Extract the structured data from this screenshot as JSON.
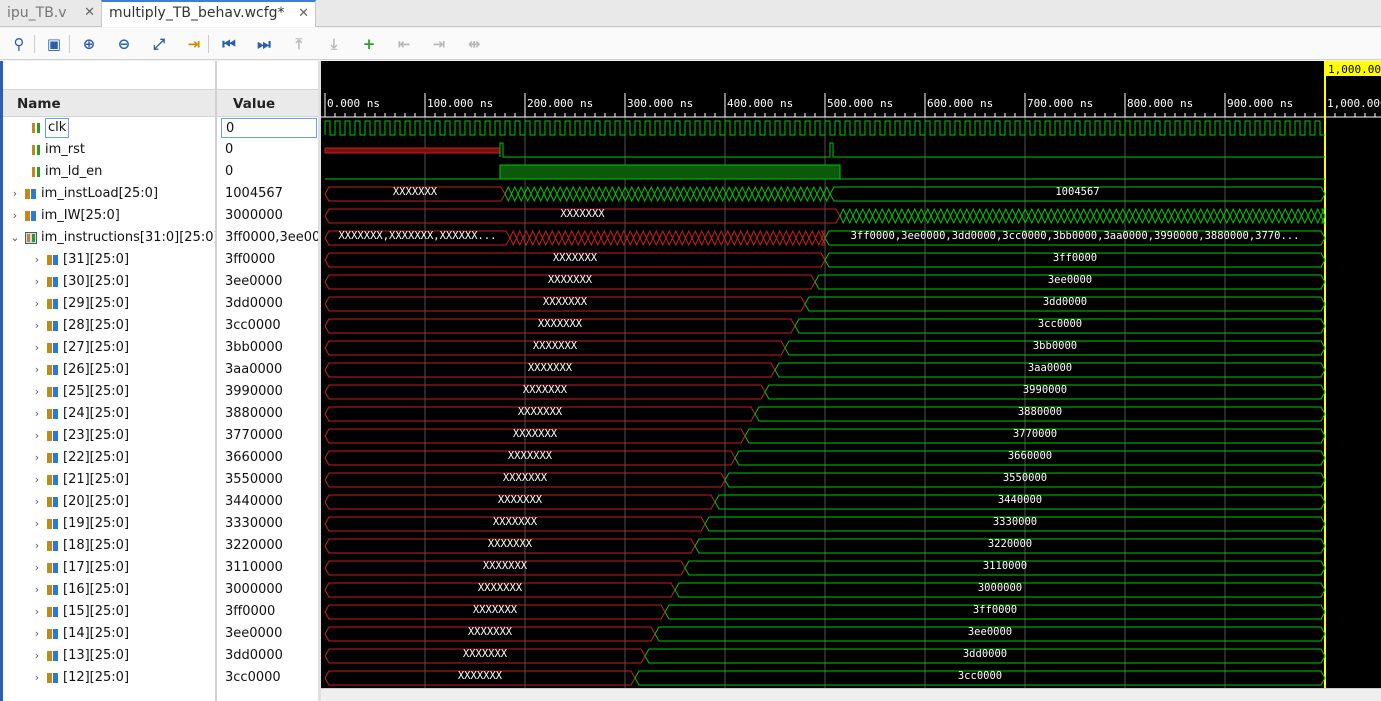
{
  "tabs": [
    {
      "label": "ipu_TB.v",
      "active": false
    },
    {
      "label": "multiply_TB_behav.wcfg*",
      "active": true
    }
  ],
  "toolbar_icons": [
    "search-icon",
    "save-icon",
    "zoom-in-icon",
    "zoom-out-icon",
    "zoom-fit-icon",
    "go-to-cursor-icon",
    "go-to-time-zero-icon",
    "go-to-last-time-icon",
    "previous-transition-icon",
    "next-transition-icon",
    "add-marker-icon",
    "previous-marker-icon",
    "next-marker-icon",
    "swap-cursors-icon"
  ],
  "columns": {
    "name": "Name",
    "value": "Value"
  },
  "time_axis": {
    "ticks": [
      "0.000 ns",
      "100.000 ns",
      "200.000 ns",
      "300.000 ns",
      "400.000 ns",
      "500.000 ns",
      "600.000 ns",
      "700.000 ns",
      "800.000 ns",
      "900.000 ns",
      "1,000.000 ns"
    ],
    "cursor_label": "1,000.000 ns",
    "cursor_ns": 1000
  },
  "colors": {
    "wave_green": "#00c800",
    "wave_red": "#c81e1e",
    "cursor": "#ffff00",
    "grid": "#505050"
  },
  "signals": [
    {
      "name": "clk",
      "value": "0",
      "kind": "bit",
      "expandable": false,
      "indent": 0
    },
    {
      "name": "im_rst",
      "value": "0",
      "kind": "bit",
      "expandable": false,
      "indent": 0
    },
    {
      "name": "im_ld_en",
      "value": "0",
      "kind": "bit",
      "expandable": false,
      "indent": 0
    },
    {
      "name": "im_instLoad[25:0]",
      "value": "1004567",
      "kind": "bus",
      "expandable": true,
      "expanded": false,
      "indent": 0
    },
    {
      "name": "im_IW[25:0]",
      "value": "3000000",
      "kind": "bus",
      "expandable": true,
      "expanded": false,
      "indent": 0
    },
    {
      "name": "im_instructions[31:0][25:0]",
      "value": "3ff0000,3ee00",
      "kind": "array",
      "expandable": true,
      "expanded": true,
      "indent": 0
    },
    {
      "name": "[31][25:0]",
      "value": "3ff0000",
      "kind": "bus",
      "expandable": true,
      "indent": 1
    },
    {
      "name": "[30][25:0]",
      "value": "3ee0000",
      "kind": "bus",
      "expandable": true,
      "indent": 1
    },
    {
      "name": "[29][25:0]",
      "value": "3dd0000",
      "kind": "bus",
      "expandable": true,
      "indent": 1
    },
    {
      "name": "[28][25:0]",
      "value": "3cc0000",
      "kind": "bus",
      "expandable": true,
      "indent": 1
    },
    {
      "name": "[27][25:0]",
      "value": "3bb0000",
      "kind": "bus",
      "expandable": true,
      "indent": 1
    },
    {
      "name": "[26][25:0]",
      "value": "3aa0000",
      "kind": "bus",
      "expandable": true,
      "indent": 1
    },
    {
      "name": "[25][25:0]",
      "value": "3990000",
      "kind": "bus",
      "expandable": true,
      "indent": 1
    },
    {
      "name": "[24][25:0]",
      "value": "3880000",
      "kind": "bus",
      "expandable": true,
      "indent": 1
    },
    {
      "name": "[23][25:0]",
      "value": "3770000",
      "kind": "bus",
      "expandable": true,
      "indent": 1
    },
    {
      "name": "[22][25:0]",
      "value": "3660000",
      "kind": "bus",
      "expandable": true,
      "indent": 1
    },
    {
      "name": "[21][25:0]",
      "value": "3550000",
      "kind": "bus",
      "expandable": true,
      "indent": 1
    },
    {
      "name": "[20][25:0]",
      "value": "3440000",
      "kind": "bus",
      "expandable": true,
      "indent": 1
    },
    {
      "name": "[19][25:0]",
      "value": "3330000",
      "kind": "bus",
      "expandable": true,
      "indent": 1
    },
    {
      "name": "[18][25:0]",
      "value": "3220000",
      "kind": "bus",
      "expandable": true,
      "indent": 1
    },
    {
      "name": "[17][25:0]",
      "value": "3110000",
      "kind": "bus",
      "expandable": true,
      "indent": 1
    },
    {
      "name": "[16][25:0]",
      "value": "3000000",
      "kind": "bus",
      "expandable": true,
      "indent": 1
    },
    {
      "name": "[15][25:0]",
      "value": "3ff0000",
      "kind": "bus",
      "expandable": true,
      "indent": 1
    },
    {
      "name": "[14][25:0]",
      "value": "3ee0000",
      "kind": "bus",
      "expandable": true,
      "indent": 1
    },
    {
      "name": "[13][25:0]",
      "value": "3dd0000",
      "kind": "bus",
      "expandable": true,
      "indent": 1
    },
    {
      "name": "[12][25:0]",
      "value": "3cc0000",
      "kind": "bus",
      "expandable": true,
      "indent": 1
    }
  ],
  "waves": {
    "unknown_label": "XXXXXXX",
    "instructions_pre_label": "XXXXXXX,XXXXXXX,XXXXXX...",
    "instructions_post_label": "3ff0000,3ee0000,3dd0000,3cc0000,3bb0000,3aa0000,3990000,3880000,3770...",
    "rst_pulses_ns": [
      175,
      505
    ],
    "ld_en_window_ns": [
      175,
      515
    ],
    "instload_change_ns": [
      180,
      505
    ],
    "iw_change_ns": 515,
    "instructions_change_ns": [
      185,
      500
    ],
    "element_change_ns": [
      500,
      490,
      480,
      470,
      460,
      450,
      440,
      430,
      420,
      410,
      400,
      390,
      380,
      370,
      360,
      350,
      340,
      330,
      320,
      310
    ]
  }
}
